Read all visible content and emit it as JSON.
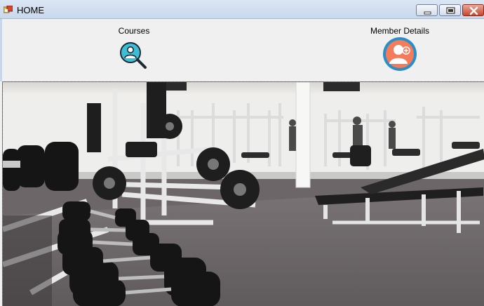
{
  "window": {
    "title": "HOME",
    "icon": "app-form-icon",
    "controls": [
      "minimize-icon",
      "maximize-icon",
      "close-icon"
    ]
  },
  "nav": {
    "courses": {
      "label": "Courses",
      "icon": "user-search-icon"
    },
    "member_details": {
      "label": "Member Details",
      "icon": "add-user-avatar-icon"
    }
  },
  "main": {
    "image": "gym-interior-photo"
  },
  "colors": {
    "titlebar": "#c9d8ec",
    "courses_icon": "#3cbfd6",
    "member_icon_ring": "#2a8ec9",
    "member_icon_fill": "#f47c5a",
    "close_button": "#c8452c"
  }
}
